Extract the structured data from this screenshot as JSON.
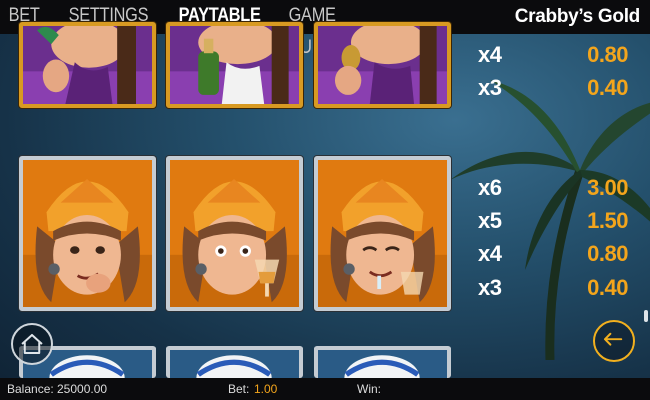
{
  "nav": {
    "tabs": [
      {
        "label": "BET"
      },
      {
        "label": "SETTINGS"
      },
      {
        "label": "PAYTABLE",
        "active": true
      },
      {
        "label": "GAME RULES"
      }
    ],
    "game_title": "Crabby’s Gold"
  },
  "paytable": {
    "purple_row": [
      {
        "count": "x4",
        "value": "0.80"
      },
      {
        "count": "x3",
        "value": "0.40"
      }
    ],
    "lady_row": [
      {
        "count": "x6",
        "value": "3.00"
      },
      {
        "count": "x5",
        "value": "1.50"
      },
      {
        "count": "x4",
        "value": "0.80"
      },
      {
        "count": "x3",
        "value": "0.40"
      }
    ]
  },
  "footer": {
    "balance_label": "Balance:",
    "balance_value": "25000.00",
    "bet_label": "Bet:",
    "bet_value": "1.00",
    "win_label": "Win:",
    "win_value": ""
  },
  "colors": {
    "accent": "#f3a51c",
    "count_text": "#ffffff",
    "bar_background": "#0b0b0d",
    "gold_frame": "#d89a22",
    "silver_frame": "#c5ccd3"
  },
  "icons": {
    "home": "home-icon",
    "back": "arrow-left-icon"
  }
}
